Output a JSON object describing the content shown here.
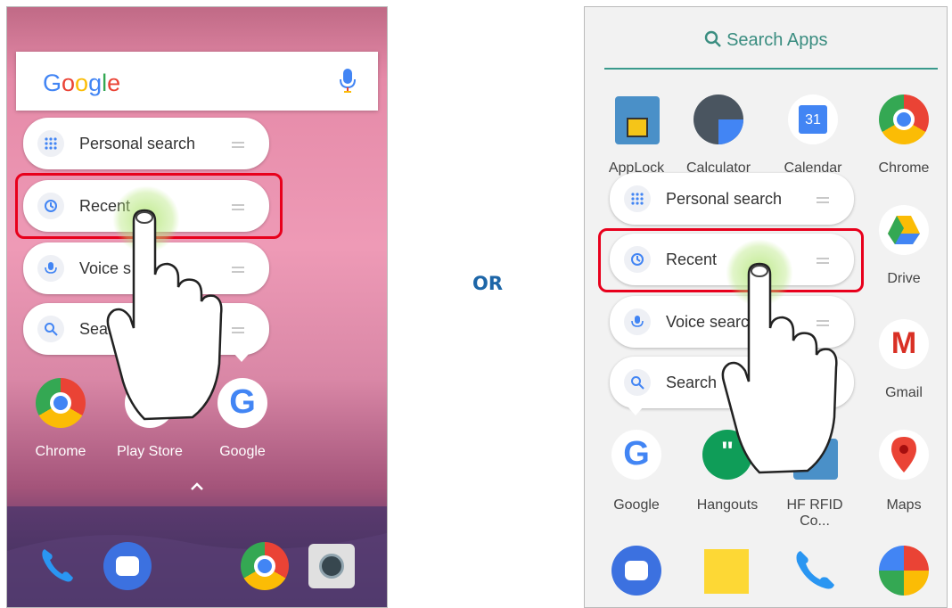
{
  "left_phone": {
    "google_logo": "Google",
    "shortcuts": [
      {
        "label": "Personal search",
        "icon": "apps-grid-icon"
      },
      {
        "label": "Recent",
        "icon": "history-icon"
      },
      {
        "label": "Voice search",
        "icon": "mic-icon"
      },
      {
        "label": "Search",
        "icon": "search-icon"
      }
    ],
    "shortcut_visible_labels": [
      "Personal search",
      "Recent",
      "Voice s",
      "Sear"
    ],
    "apps": [
      "Chrome",
      "Play Store",
      "Google"
    ],
    "dock": [
      "phone-icon",
      "messages-icon",
      "chrome-icon",
      "camera-icon"
    ]
  },
  "separator": "OR",
  "right_phone": {
    "search_label": "Search Apps",
    "calendar_day": "31",
    "apps_row1": [
      "AppLock",
      "Calculator",
      "Calendar",
      "Chrome"
    ],
    "apps_row1_visible": [
      "AppLock",
      "Calculator",
      "Calendar",
      "Chrome"
    ],
    "drive_label": "Drive",
    "gmail_label": "Gmail",
    "apps_row3": [
      "Google",
      "Hangouts",
      "HF RFID Co...",
      "Maps"
    ],
    "shortcuts": [
      {
        "label": "Personal search"
      },
      {
        "label": "Recent"
      },
      {
        "label": "Voice search"
      },
      {
        "label": "Search"
      }
    ],
    "shortcut_visible_labels": [
      "Personal search",
      "Recent",
      "Voice search",
      "Search"
    ]
  },
  "colors": {
    "highlight": "#e8001c",
    "or_text": "#1d66a8",
    "teal": "#3a8d80"
  }
}
